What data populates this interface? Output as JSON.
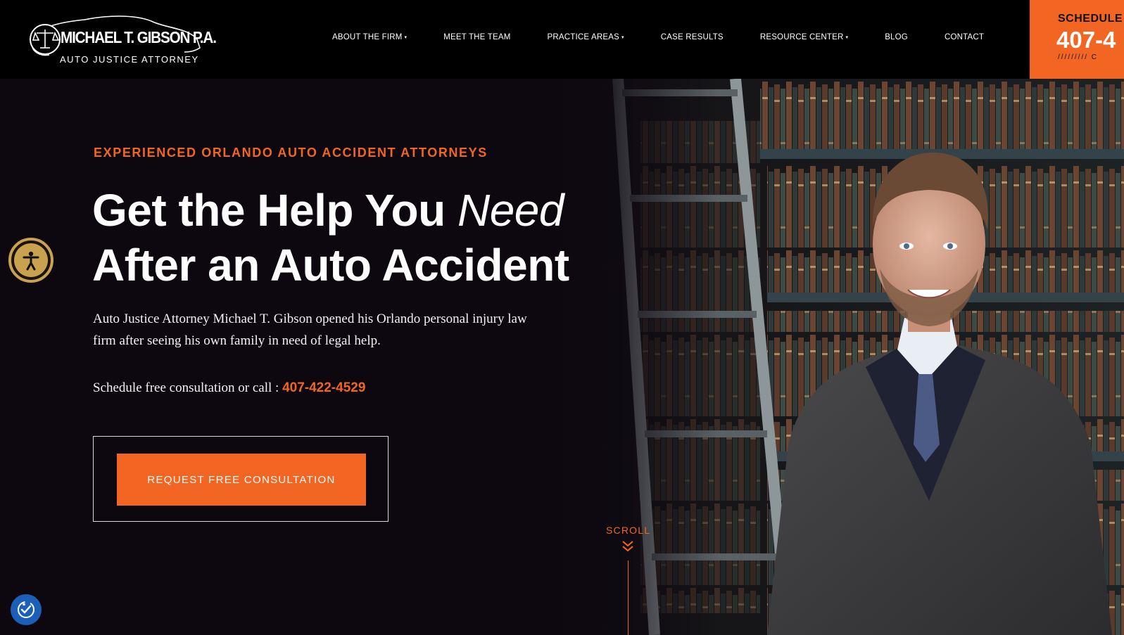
{
  "brand": {
    "name": "MICHAEL T. GIBSON P.A.",
    "tagline": "AUTO JUSTICE ATTORNEY"
  },
  "nav": {
    "items": [
      {
        "label": "ABOUT THE FIRM",
        "dropdown": true
      },
      {
        "label": "MEET THE TEAM",
        "dropdown": false
      },
      {
        "label": "PRACTICE AREAS",
        "dropdown": true
      },
      {
        "label": "CASE RESULTS",
        "dropdown": false
      },
      {
        "label": "RESOURCE CENTER",
        "dropdown": true
      },
      {
        "label": "BLOG",
        "dropdown": false
      },
      {
        "label": "CONTACT",
        "dropdown": false
      }
    ],
    "caret": "▾"
  },
  "schedule": {
    "label": "SCHEDULE I",
    "phone": "407-4",
    "decor": "/////////  C"
  },
  "hero": {
    "eyebrow": "EXPERIENCED ORLANDO AUTO ACCIDENT ATTORNEYS",
    "headline_part1": "Get the Help You ",
    "headline_italic": "Need",
    "headline_line2": "After an Auto Accident",
    "intro": "Auto Justice Attorney Michael T. Gibson opened his Orlando personal injury law firm after seeing his own family in need of legal help.",
    "call_text": "Schedule free consultation or call : ",
    "phone": "407-422-4529",
    "cta_label": "REQUEST FREE CONSULTATION",
    "scroll_label": "SCROLL"
  },
  "colors": {
    "accent": "#f26522",
    "background": "#0d0810",
    "accessibility_gold": "#c9a24f",
    "widget_blue": "#1c5fb6"
  },
  "icons": {
    "accessibility": "accessibility-person-icon",
    "widget": "accessibility-widget-icon",
    "scroll": "double-chevron-down-icon",
    "logo_scales": "scales-of-justice-icon"
  }
}
